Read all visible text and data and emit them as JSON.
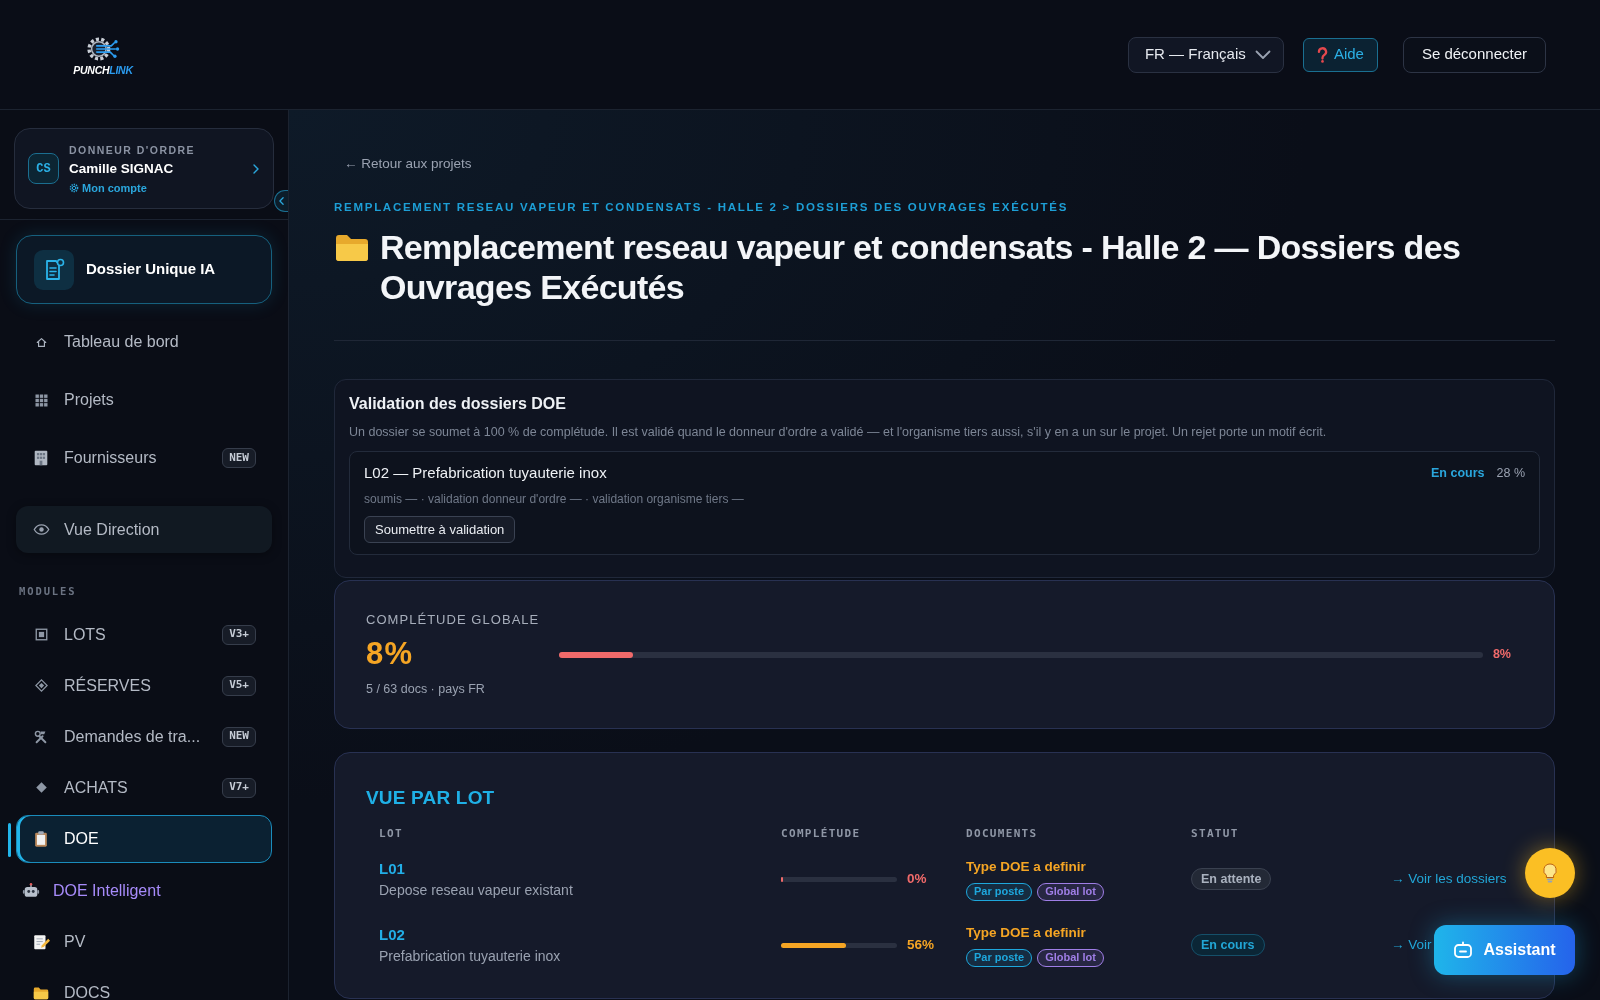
{
  "header": {
    "logo": {
      "main": "PUNCH",
      "accent": "LINK"
    },
    "language": "FR — Français",
    "help": "Aide",
    "logout": "Se déconnecter"
  },
  "sidebar": {
    "profile": {
      "initials": "CS",
      "role": "DONNEUR D'ORDRE",
      "name": "Camille SIGNAC",
      "account_link": "Mon compte"
    },
    "featured": {
      "label": "Dossier Unique IA"
    },
    "items": [
      {
        "label": "Tableau de bord",
        "kind": "link",
        "selected": false
      },
      {
        "label": "Projets",
        "kind": "link",
        "selected": false
      },
      {
        "label": "Fournisseurs",
        "kind": "link",
        "badge": "NEW",
        "selected": false
      },
      {
        "label": "Vue Direction",
        "kind": "panel",
        "selected": false
      }
    ],
    "modules_label": "MODULES",
    "modules": [
      {
        "label": "LOTS",
        "kind": "link",
        "badge": "V3+",
        "selected": false
      },
      {
        "label": "RÉSERVES",
        "kind": "link",
        "badge": "V5+",
        "selected": false
      },
      {
        "label": "Demandes de tra...",
        "kind": "link",
        "badge": "NEW",
        "selected": false
      },
      {
        "label": "ACHATS",
        "kind": "link",
        "badge": "V7+",
        "selected": false
      },
      {
        "label": "DOE",
        "kind": "link",
        "selected": true
      },
      {
        "label": "DOE Intelligent",
        "kind": "ai",
        "selected": false
      },
      {
        "label": "PV",
        "kind": "link",
        "selected": false
      },
      {
        "label": "DOCS",
        "kind": "link",
        "selected": false
      }
    ]
  },
  "page": {
    "back_link": "← Retour aux projets",
    "breadcrumb": "REMPLACEMENT RESEAU VAPEUR ET CONDENSATS - HALLE 2 > DOSSIERS DES OUVRAGES EXÉCUTÉS",
    "title": "Remplacement reseau vapeur et condensats - Halle 2 — Dossiers des Ouvrages Exécutés"
  },
  "validation": {
    "title": "Validation des dossiers DOE",
    "description": "Un dossier se soumet à 100 % de complétude. Il est validé quand le donneur d'ordre a validé — et l'organisme tiers aussi, s'il y en a un sur le projet. Un rejet porte un motif écrit.",
    "dossiers": [
      {
        "title": "L02 — Prefabrication tuyauterie inox",
        "status": {
          "label": "En cours",
          "kind": "in_progress"
        },
        "percent": "28 %",
        "steps": "soumis — · validation donneur d'ordre — · validation organisme tiers —",
        "action": "Soumettre à validation"
      }
    ]
  },
  "completion": {
    "label": "COMPLÉTUDE GLOBALE",
    "value": "8%",
    "level": 0.08,
    "reading": "8%",
    "detail": "5 / 63 docs · pays FR"
  },
  "lots": {
    "title": "VUE PAR LOT",
    "columns": [
      "LOT",
      "COMPLÉTUDE",
      "DOCUMENTS",
      "STATUT"
    ],
    "rows": [
      {
        "code": "L01",
        "name": "Depose reseau vapeur existant",
        "level": 0,
        "percent": "0%",
        "doc_type": "Type DOE a definir",
        "tags": [
          {
            "label": "Par poste",
            "color": "#1ea7dc"
          },
          {
            "label": "Global lot",
            "color": "#9f7ee6"
          }
        ],
        "status": {
          "label": "En attente",
          "kind": "pending"
        },
        "action": "→ Voir les dossiers"
      },
      {
        "code": "L02",
        "name": "Prefabrication tuyauterie inox",
        "level": 0.56,
        "percent": "56%",
        "doc_type": "Type DOE a definir",
        "tags": [
          {
            "label": "Par poste",
            "color": "#1ea7dc"
          },
          {
            "label": "Global lot",
            "color": "#9f7ee6"
          }
        ],
        "status": {
          "label": "En cours",
          "kind": "in_progress"
        },
        "action": "→ Voir"
      }
    ]
  },
  "floating": {
    "assistant": "Assistant"
  }
}
